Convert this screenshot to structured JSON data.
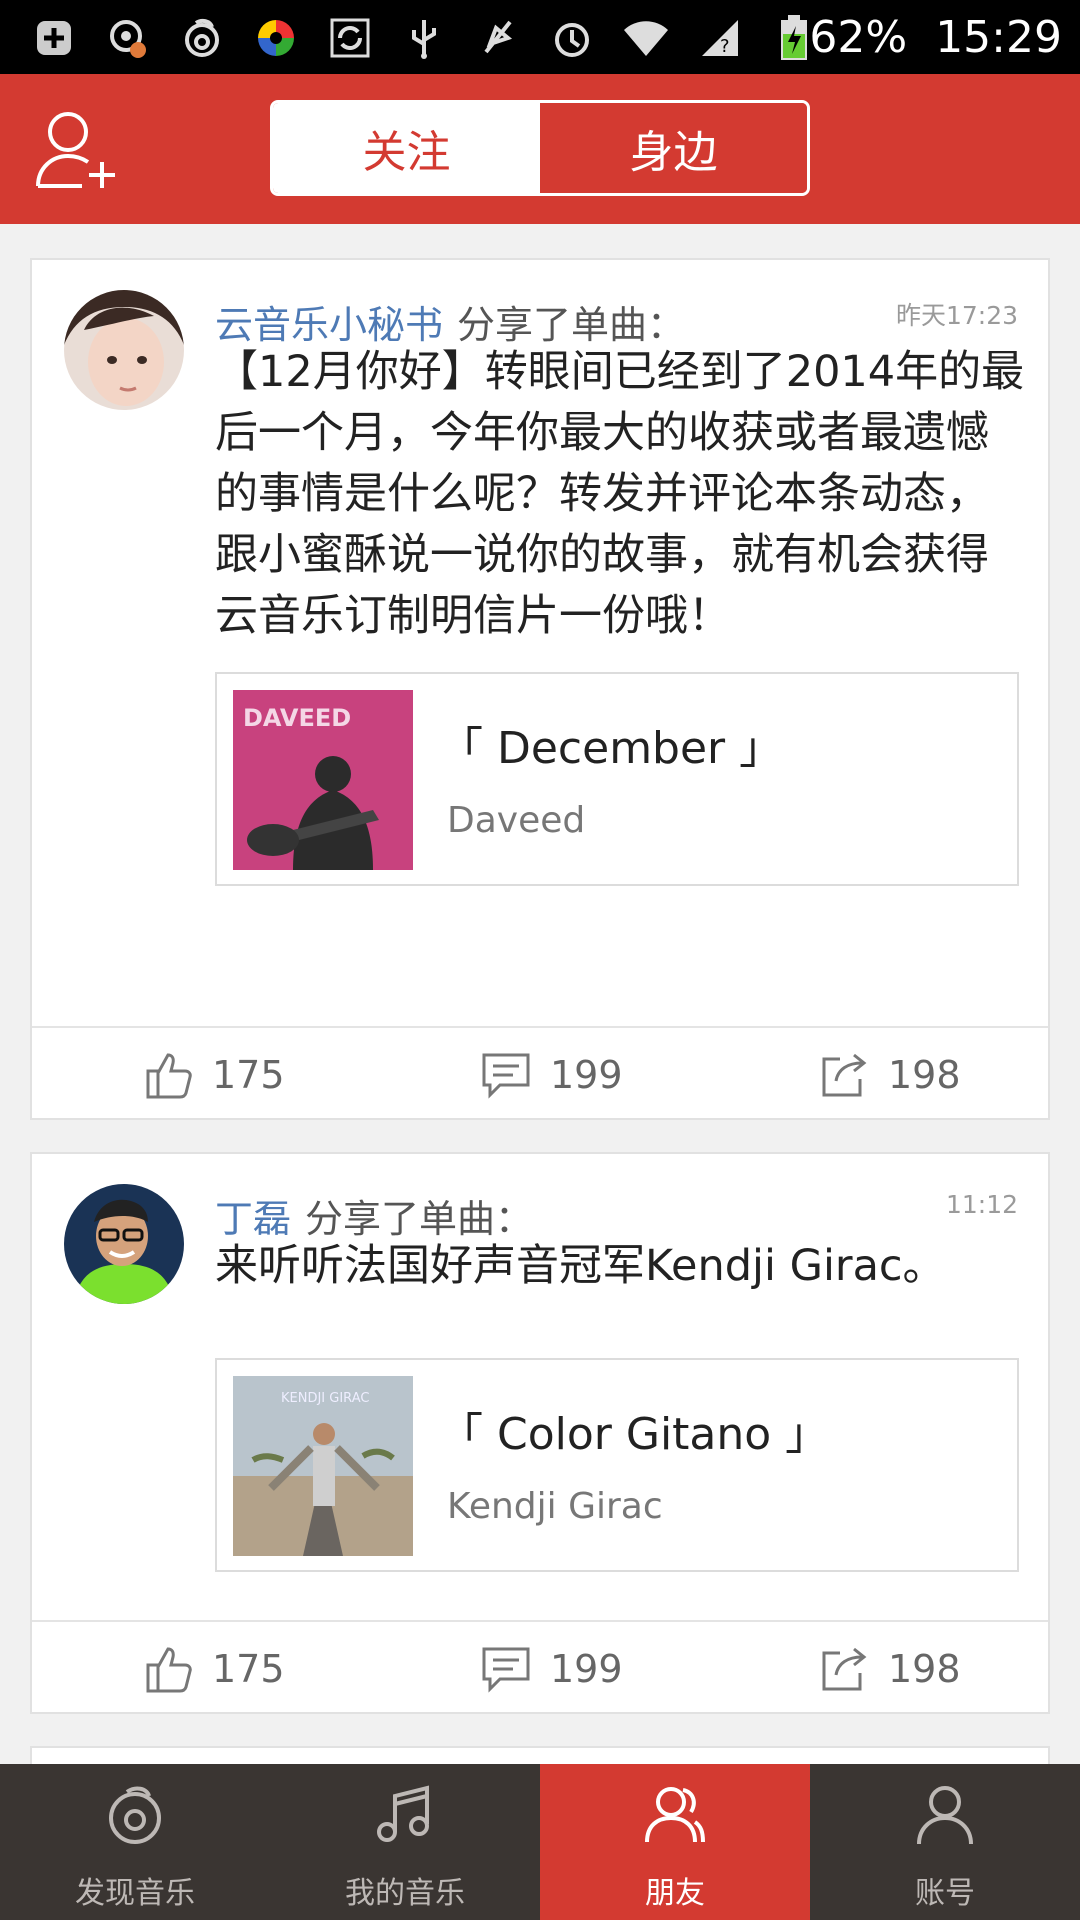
{
  "status_bar": {
    "icons": [
      "plus-box-icon",
      "notification-badge-icon",
      "netease-music-icon",
      "color-wheel-icon",
      "sync-icon",
      "usb-icon",
      "mute-icon",
      "alarm-icon",
      "wifi-icon",
      "signal-icon",
      "battery-charging-icon"
    ],
    "battery": "62%",
    "time": "15:29"
  },
  "header": {
    "tabs": [
      {
        "label": "关注",
        "state": "selected"
      },
      {
        "label": "身边",
        "state": "unselected"
      }
    ]
  },
  "feed": [
    {
      "user": "云音乐小秘书",
      "action": "分享了单曲：",
      "time": "昨天17:23",
      "text": "【12月你好】转眼间已经到了2014年的最后一个月，今年你最大的收获或者最遗憾的事情是什么呢？转发并评论本条动态，跟小蜜酥说一说你的故事，就有机会获得云音乐订制明信片一份哦！",
      "song_title": "「 December 」",
      "song_artist": "Daveed",
      "cover_text": "DAVEED",
      "likes": "175",
      "comments": "199",
      "shares": "198"
    },
    {
      "user": "丁磊",
      "action": "分享了单曲：",
      "time": "11:12",
      "text": "来听听法国好声音冠军Kendji Girac。",
      "song_title": "「 Color Gitano 」",
      "song_artist": "Kendji Girac",
      "cover_text": "KENDJI GIRAC",
      "likes": "175",
      "comments": "199",
      "shares": "198"
    }
  ],
  "bottom_nav": [
    {
      "label": "发现音乐",
      "icon": "discover-music-icon"
    },
    {
      "label": "我的音乐",
      "icon": "music-note-icon"
    },
    {
      "label": "朋友",
      "icon": "friends-icon",
      "active": true
    },
    {
      "label": "账号",
      "icon": "account-icon"
    }
  ],
  "colors": {
    "brand_red": "#d33a31",
    "username_blue": "#4e7ab5",
    "nav_bg": "#3a3532"
  }
}
